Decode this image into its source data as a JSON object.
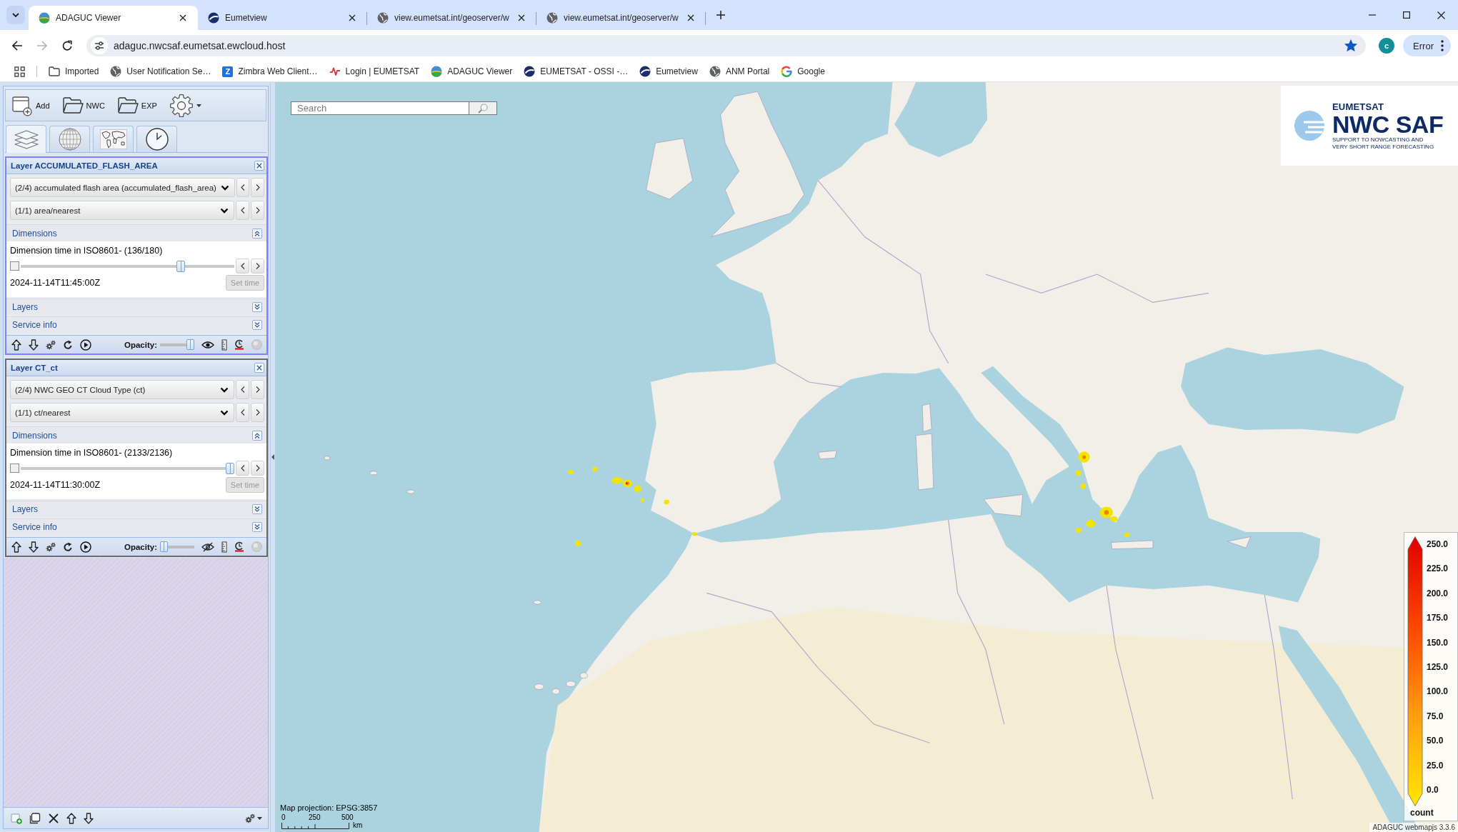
{
  "browser": {
    "tabs": [
      {
        "kind": "adaguc",
        "title": "ADAGUC Viewer",
        "selected": true
      },
      {
        "kind": "eumetsat",
        "title": "Eumetview",
        "selected": false
      },
      {
        "kind": "globe",
        "title": "view.eumetsat.int/geoserver/w",
        "selected": false
      },
      {
        "kind": "globe",
        "title": "view.eumetsat.int/geoserver/w",
        "selected": false
      }
    ],
    "navigation": [
      {
        "kind": "back",
        "disabled": false
      },
      {
        "kind": "forward",
        "disabled": true
      },
      {
        "kind": "reload",
        "disabled": false
      }
    ],
    "address": {
      "url": "adaguc.nwcsaf.eumetsat.ewcloud.host",
      "starred": true
    },
    "profile": {
      "initial": "c"
    },
    "menu": {
      "label": "Error"
    },
    "bookmarks": [
      {
        "kind": "folder",
        "label": "Imported"
      },
      {
        "kind": "globe",
        "label": "User Notification Se…"
      },
      {
        "kind": "badge",
        "badge": "Z",
        "label": "Zimbra Web Client…"
      },
      {
        "kind": "pulse",
        "label": "Login | EUMETSAT"
      },
      {
        "kind": "adaguc",
        "label": "ADAGUC Viewer"
      },
      {
        "kind": "eumetsat",
        "label": "EUMETSAT - OSSI -…"
      },
      {
        "kind": "eumetsat",
        "label": "Eumetview"
      },
      {
        "kind": "globe",
        "label": "ANM Portal"
      },
      {
        "kind": "google",
        "label": "Google"
      }
    ]
  },
  "toolbar": [
    {
      "kind": "add",
      "label": "Add"
    },
    {
      "kind": "folder",
      "label": "NWC"
    },
    {
      "kind": "folder",
      "label": "EXP"
    },
    {
      "kind": "settings"
    }
  ],
  "panel_tabs": [
    {
      "kind": "layers",
      "selected": true
    },
    {
      "kind": "globe",
      "selected": false
    },
    {
      "kind": "map",
      "selected": false
    },
    {
      "kind": "clock",
      "selected": false
    }
  ],
  "layers": [
    {
      "title": "Layer ACCUMULATED_FLASH_AREA",
      "selected": true,
      "selects": [
        "(2/4) accumulated flash area (accumulated_flash_area)",
        "(1/1) area/nearest"
      ],
      "sections": [
        {
          "label": "Dimensions",
          "expanded": true,
          "content": {
            "title": "Dimension time in ISO8601- (136/180)",
            "checked": false,
            "level": 0.76,
            "value": "2024-11-14T11:45:00Z",
            "button": "Set time",
            "disabled": true
          }
        },
        {
          "label": "Layers",
          "expanded": false
        },
        {
          "label": "Service info",
          "expanded": false
        }
      ],
      "opacity": {
        "label": "Opacity:",
        "level": 1
      },
      "visible": true
    },
    {
      "title": "Layer CT_ct",
      "selected": false,
      "selects": [
        "(2/4) NWC GEO CT Cloud Type (ct)",
        "(1/1) ct/nearest"
      ],
      "sections": [
        {
          "label": "Dimensions",
          "expanded": true,
          "content": {
            "title": "Dimension time in ISO8601- (2133/2136)",
            "checked": false,
            "level": 1,
            "value": "2024-11-14T11:30:00Z",
            "button": "Set time",
            "disabled": true
          }
        },
        {
          "label": "Layers",
          "expanded": false
        },
        {
          "label": "Service info",
          "expanded": false
        }
      ],
      "opacity": {
        "label": "Opacity:",
        "level": 0
      },
      "visible": false
    }
  ],
  "map": {
    "search": {
      "placeholder": "Search"
    },
    "logo": {
      "org": "EUMETSAT",
      "name": "NWC SAF",
      "tagline": [
        "SUPPORT TO NOWCASTING AND",
        "VERY SHORT RANGE FORECASTING"
      ]
    },
    "legend": {
      "ticks": [
        "250.0",
        "225.0",
        "200.0",
        "175.0",
        "150.0",
        "125.0",
        "100.0",
        "75.0",
        "50.0",
        "25.0",
        "0.0"
      ],
      "unit": "count"
    },
    "projection": "Map projection: EPSG:3857",
    "scale": {
      "ticks": [
        "0",
        "250",
        "500"
      ],
      "unit": "km"
    },
    "attribution": "ADAGUC webmapjs 3.3.6"
  }
}
